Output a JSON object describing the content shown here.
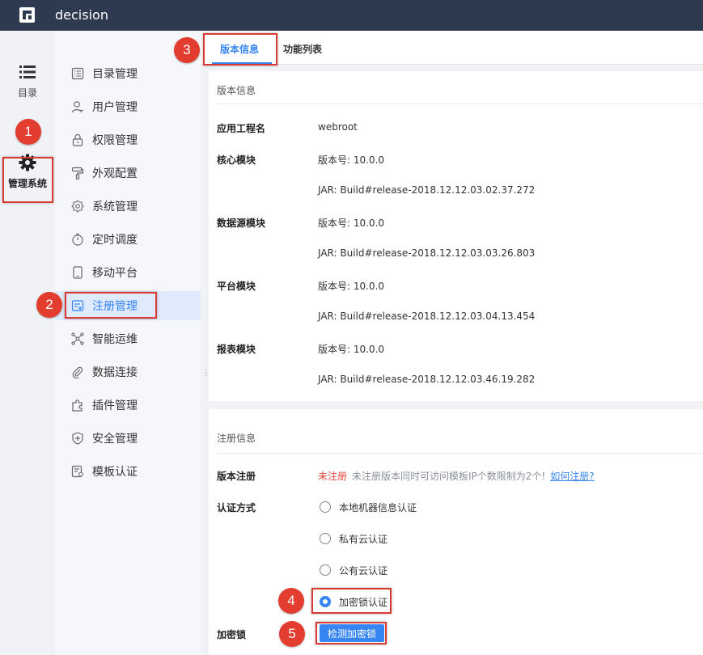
{
  "app": {
    "title": "decision"
  },
  "rail": {
    "catalog_label": "目录",
    "admin_label": "管理系统"
  },
  "sidebar": {
    "items": [
      {
        "label": "目录管理",
        "icon": "list-icon"
      },
      {
        "label": "用户管理",
        "icon": "user-icon"
      },
      {
        "label": "权限管理",
        "icon": "lock-icon"
      },
      {
        "label": "外观配置",
        "icon": "paint-roller-icon"
      },
      {
        "label": "系统管理",
        "icon": "gear-icon"
      },
      {
        "label": "定时调度",
        "icon": "stopwatch-icon"
      },
      {
        "label": "移动平台",
        "icon": "mobile-icon"
      },
      {
        "label": "注册管理",
        "icon": "register-icon",
        "active": true
      },
      {
        "label": "智能运维",
        "icon": "network-icon"
      },
      {
        "label": "数据连接",
        "icon": "paperclip-icon"
      },
      {
        "label": "插件管理",
        "icon": "puzzle-icon"
      },
      {
        "label": "安全管理",
        "icon": "shield-icon"
      },
      {
        "label": "模板认证",
        "icon": "template-cert-icon"
      }
    ]
  },
  "tabs": [
    {
      "label": "版本信息",
      "active": true
    },
    {
      "label": "功能列表"
    }
  ],
  "version_panel": {
    "header": "版本信息",
    "rows": [
      {
        "label": "应用工程名",
        "value": "webroot"
      },
      {
        "label": "核心模块",
        "value": "版本号: 10.0.0"
      },
      {
        "label": "",
        "value": "JAR: Build#release-2018.12.12.03.02.37.272"
      },
      {
        "label": "数据源模块",
        "value": "版本号: 10.0.0"
      },
      {
        "label": "",
        "value": "JAR: Build#release-2018.12.12.03.03.26.803"
      },
      {
        "label": "平台模块",
        "value": "版本号: 10.0.0"
      },
      {
        "label": "",
        "value": "JAR: Build#release-2018.12.12.03.04.13.454"
      },
      {
        "label": "报表模块",
        "value": "版本号: 10.0.0"
      },
      {
        "label": "",
        "value": "JAR: Build#release-2018.12.12.03.46.19.282"
      }
    ]
  },
  "reg_panel": {
    "header": "注册信息",
    "version_reg_label": "版本注册",
    "status": "未注册",
    "hint": "未注册版本同时可访问模板IP个数限制为2个!",
    "link": "如何注册?",
    "auth_label": "认证方式",
    "auth_options": [
      {
        "label": "本地机器信息认证",
        "checked": false
      },
      {
        "label": "私有云认证",
        "checked": false
      },
      {
        "label": "公有云认证",
        "checked": false
      },
      {
        "label": "加密锁认证",
        "checked": true
      }
    ],
    "dongle_label": "加密锁",
    "detect_button": "检测加密锁"
  },
  "annotations": [
    "1",
    "2",
    "3",
    "4",
    "5"
  ],
  "colors": {
    "topbar": "#2d3a4f",
    "accent": "#3685f2",
    "marker": "#e23d2e",
    "status_red": "#e5493d"
  }
}
